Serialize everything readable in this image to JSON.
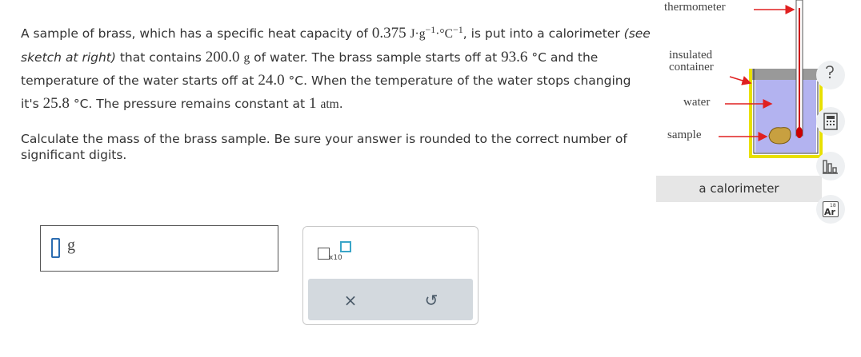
{
  "problem": {
    "p1": "A sample of brass, which has a specific heat capacity of ",
    "heat_capacity_value": "0.375",
    "heat_capacity_unit_j": "J·g",
    "exp1": "−1",
    "dot_unit_c": "·°C",
    "exp2": "−1",
    "p2": ", is put into a calorimeter ",
    "sketch_ref": "(see sketch at right)",
    "p3": " that contains ",
    "water_mass": "200.0",
    "g_unit": "g",
    "p4": " of water. The brass sample starts off at ",
    "brass_temp": "93.6",
    "p5": " °C and the temperature of the water starts off at ",
    "water_temp": "24.0",
    "p6": " °C. When the temperature of the water stops changing it's ",
    "final_temp": "25.8",
    "p7": " °C. The pressure remains constant at ",
    "pressure": "1",
    "atm": "atm",
    "p8": "."
  },
  "question": "Calculate the mass of the brass sample. Be sure your answer is rounded to the correct number of significant digits.",
  "answer": {
    "value": "",
    "unit": "g"
  },
  "tools": {
    "x10_label": "x10",
    "clear_symbol": "×",
    "undo_symbol": "↺"
  },
  "sketch": {
    "thermometer_label": "thermometer",
    "insulated_label_1": "insulated",
    "insulated_label_2": "container",
    "water_label": "water",
    "sample_label": "sample",
    "caption": "a calorimeter"
  },
  "side_tools": {
    "ar_number": "18",
    "ar_symbol": "Ar"
  },
  "colors": {
    "water": "#b3b3f0",
    "thermometer_red": "#cc0000",
    "arrow_red": "#e02020",
    "input_blue": "#2b6cb0"
  }
}
